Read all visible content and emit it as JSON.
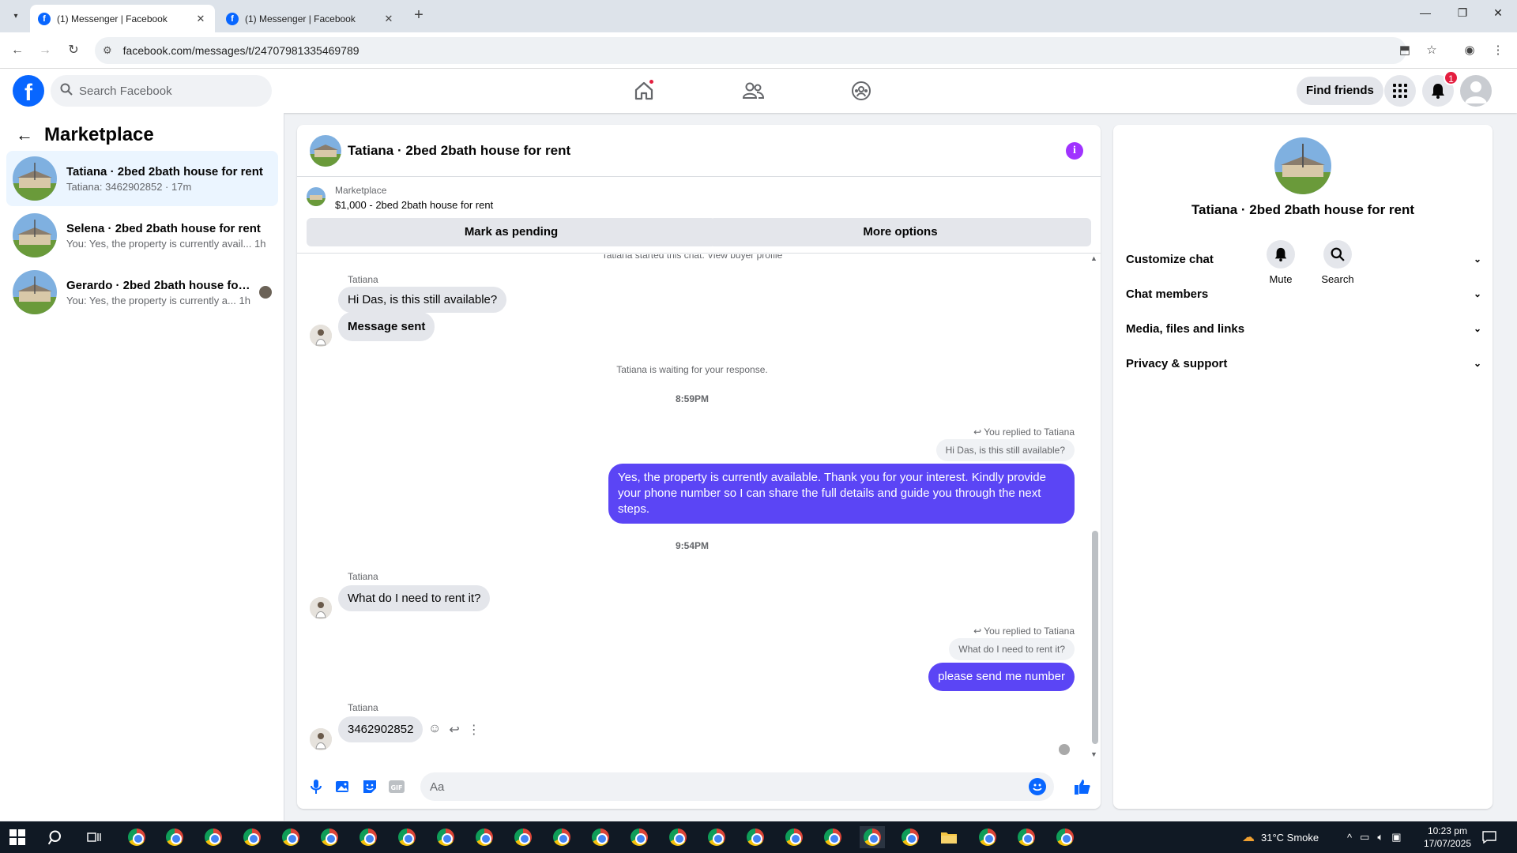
{
  "browser": {
    "tabs": [
      {
        "title": "(1) Messenger | Facebook",
        "active": true
      },
      {
        "title": "(1) Messenger | Facebook",
        "active": false
      }
    ],
    "url": "facebook.com/messages/t/24707981335469789"
  },
  "fb": {
    "search_placeholder": "Search Facebook",
    "find_friends": "Find friends",
    "notifications_count": "1"
  },
  "sidebar": {
    "title": "Marketplace",
    "conversations": [
      {
        "name": "Tatiana · 2bed 2bath house for rent",
        "preview": "Tatiana: 3462902852 · 17m",
        "active": true
      },
      {
        "name": "Selena · 2bed 2bath house for rent",
        "preview": "You: Yes, the property is currently avail...",
        "time": "1h"
      },
      {
        "name": "Gerardo · 2bed 2bath house for ...",
        "preview": "You: Yes, the property is currently a...",
        "time": "1h"
      }
    ]
  },
  "chat": {
    "title": "Tatiana · 2bed 2bath house for rent",
    "marketplace_label": "Marketplace",
    "listing": "$1,000 - 2bed 2bath house for rent",
    "mark_pending": "Mark as pending",
    "more_options": "More options",
    "top_cut": "Tatiana started this chat. View buyer profile",
    "sender_name": "Tatiana",
    "msg1": "Hi Das, is this still available?",
    "msg2": "Message sent",
    "waiting": "Tatiana is waiting for your response.",
    "time1": "8:59PM",
    "replied_to": "You replied to Tatiana",
    "quote1": "Hi Das, is this still available?",
    "reply1": "Yes, the property is currently available. Thank you for your interest. Kindly provide your phone number so I can share the full details and guide you through the next steps.",
    "time2": "9:54PM",
    "msg3": "What do I need to rent it?",
    "quote2": "What do I need to rent it?",
    "reply2": "please send me number",
    "msg4": "3462902852",
    "composer_placeholder": "Aa"
  },
  "info_panel": {
    "title": "Tatiana · 2bed 2bath house for rent",
    "mute": "Mute",
    "search": "Search",
    "sections": [
      "Customize chat",
      "Chat members",
      "Media, files and links",
      "Privacy & support"
    ]
  },
  "taskbar": {
    "weather": "31°C  Smoke",
    "time": "10:23 pm",
    "date": "17/07/2025"
  },
  "colors": {
    "fb_blue": "#0866ff",
    "outgoing_bubble": "#5b45f5",
    "info_purple": "#a033ff",
    "badge_red": "#e41e3f"
  }
}
